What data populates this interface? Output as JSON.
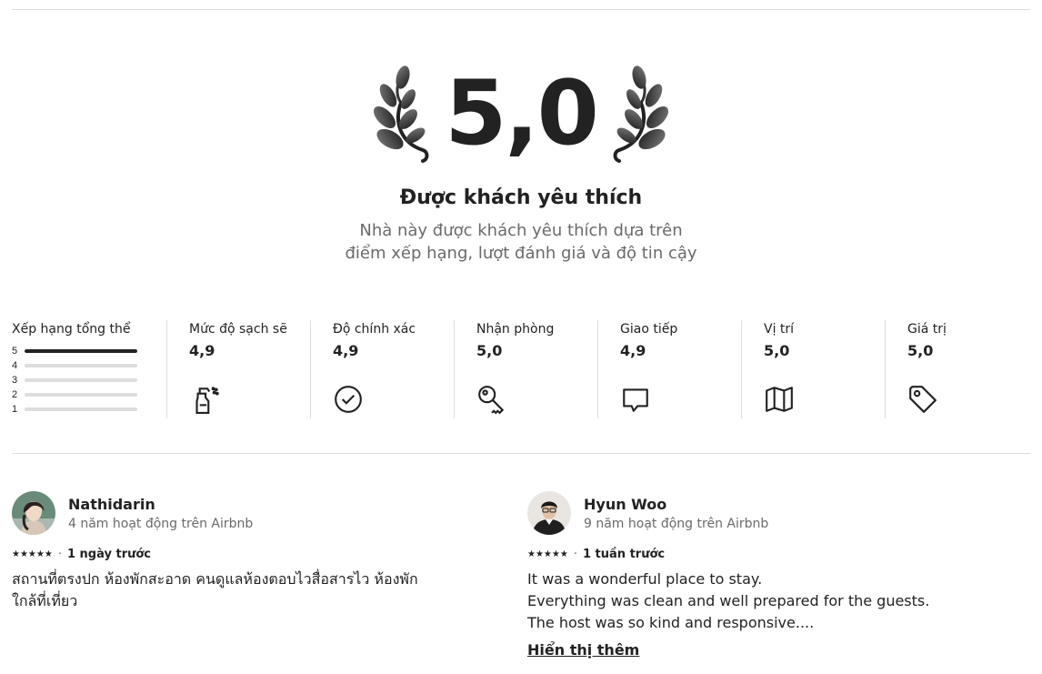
{
  "hero": {
    "rating": "5,0",
    "title": "Được khách yêu thích",
    "description": "Nhà này được khách yêu thích dựa trên điểm xếp hạng, lượt đánh giá và độ tin cậy"
  },
  "overall": {
    "label": "Xếp hạng tổng thể",
    "bars": [
      {
        "stars": "5",
        "fraction": 1.0
      },
      {
        "stars": "4",
        "fraction": 0
      },
      {
        "stars": "3",
        "fraction": 0
      },
      {
        "stars": "2",
        "fraction": 0
      },
      {
        "stars": "1",
        "fraction": 0
      }
    ]
  },
  "categories": [
    {
      "label": "Mức độ sạch sẽ",
      "value": "4,9",
      "icon": "spray-bottle-icon"
    },
    {
      "label": "Độ chính xác",
      "value": "4,9",
      "icon": "check-circle-icon"
    },
    {
      "label": "Nhận phòng",
      "value": "5,0",
      "icon": "key-icon"
    },
    {
      "label": "Giao tiếp",
      "value": "4,9",
      "icon": "chat-bubble-icon"
    },
    {
      "label": "Vị trí",
      "value": "5,0",
      "icon": "map-icon"
    },
    {
      "label": "Giá trị",
      "value": "5,0",
      "icon": "price-tag-icon"
    }
  ],
  "reviews": [
    {
      "name": "Nathidarin",
      "tenure": "4 năm hoạt động trên Airbnb",
      "stars": "★★★★★",
      "date": "1 ngày trước",
      "lines": [
        "สถานที่ตรงปก ห้องพักสะอาด คนดูแลห้องตอบไวสื่อสารไว ห้องพัก",
        "ใกล้ที่เที่ยว"
      ]
    },
    {
      "name": "Hyun Woo",
      "tenure": "9 năm hoạt động trên Airbnb",
      "stars": "★★★★★",
      "date": "1 tuần trước",
      "lines": [
        "It was a wonderful place to stay.",
        "Everything was clean and well prepared for the guests.",
        "The host was so kind and responsive...."
      ],
      "show_more": "Hiển thị thêm"
    }
  ],
  "separator": "·"
}
